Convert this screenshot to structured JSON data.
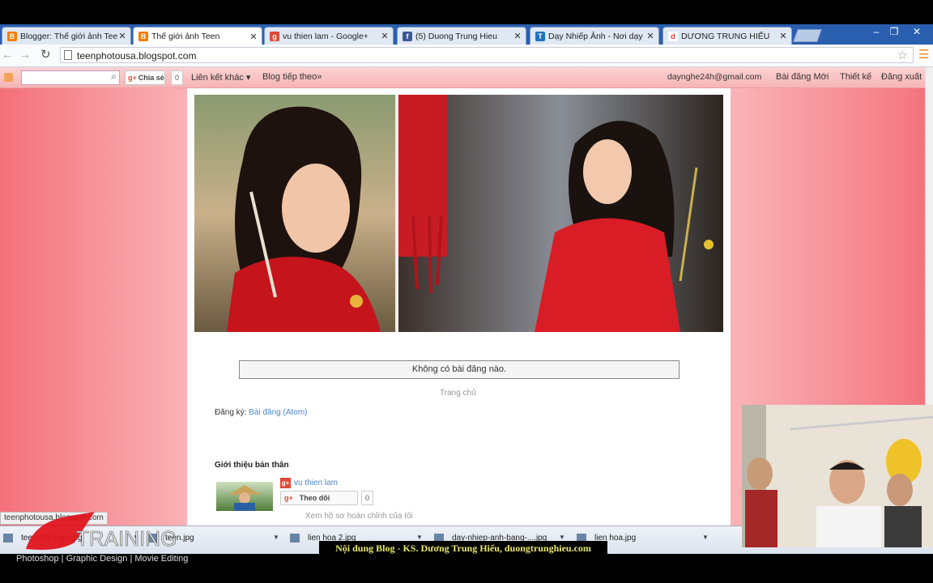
{
  "browser": {
    "tabs": [
      {
        "title": "Blogger: Thế giới ảnh Teen",
        "favicon": "blogger-icon",
        "color": "#f57d00"
      },
      {
        "title": "Thế giới ảnh Teen",
        "favicon": "blogger-icon",
        "color": "#f57d00"
      },
      {
        "title": "vu thien lam - Google+",
        "favicon": "google-plus-icon",
        "color": "#dd4b39"
      },
      {
        "title": "(5) Duong Trung Hieu",
        "favicon": "facebook-icon",
        "color": "#3b5998"
      },
      {
        "title": "Dạy Nhiếp Ảnh - Nơi dạy",
        "favicon": "site-icon",
        "color": "#1e73be"
      },
      {
        "title": "DƯƠNG TRUNG HIẾU",
        "favicon": "site-icon",
        "color": "#d33"
      }
    ],
    "active_tab": 1,
    "url": "teenphotousa.blogspot.com"
  },
  "navbar": {
    "gplus_label": "Chia sẻ",
    "gplus_count": "0",
    "more_blogs": "Liên kết khác",
    "follow": "Blog tiếp theo»",
    "email": "daynghe24h@gmail.com",
    "new_post": "Bài đăng Mới",
    "design": "Thiết kế",
    "sign_out": "Đăng xuất"
  },
  "blog": {
    "no_posts": "Không có bài đăng nào.",
    "home": "Trang chủ",
    "subscribe_label": "Đăng ký:",
    "subscribe_link": "Bài đăng (Atom)",
    "about_title": "Giới thiệu bản thân",
    "profile_name": "vu thien lam",
    "follow_btn": "Theo dõi",
    "follow_count": "0",
    "profile_link": "Xem hồ sơ hoàn chỉnh của tôi"
  },
  "status_url": "teenphotousa.blogspot.com",
  "downloads": [
    {
      "name": "teen-Sol-logo.jpg"
    },
    {
      "name": "teen.jpg"
    },
    {
      "name": "lien hoa 2.jpg"
    },
    {
      "name": "day-nhiep-anh-bang-....jpg"
    },
    {
      "name": "lien hoa.jpg"
    }
  ],
  "overlay": {
    "brand": "TRAINING",
    "tagline": "Photoshop | Graphic Design | Movie Editing",
    "caption": "Nội dung Blog - KS. Dương Trung Hiếu, duongtrunghieu.com"
  },
  "colors": {
    "page_bg": "#f9b1b5",
    "navbar": "#f8c4c6",
    "link": "#4a86c5",
    "dress_red": "#d91d26"
  }
}
